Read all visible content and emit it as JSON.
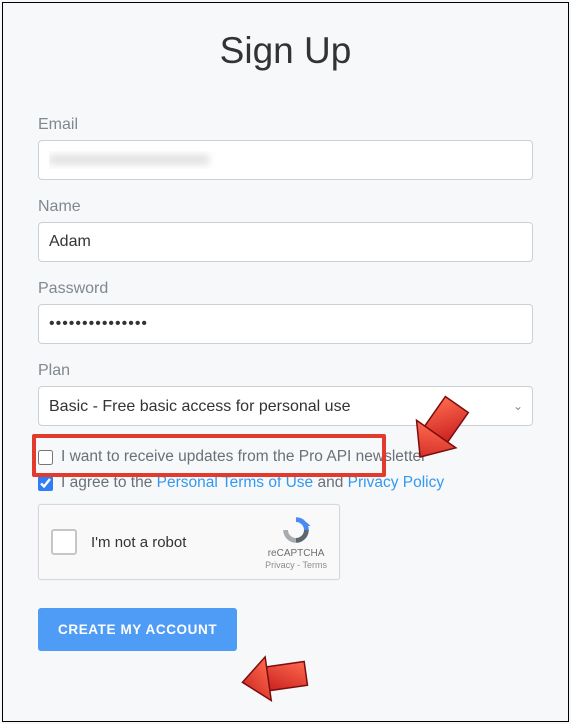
{
  "heading": "Sign Up",
  "fields": {
    "email": {
      "label": "Email",
      "value": "xxxxxxxxxxxxxxxxxxxx"
    },
    "name": {
      "label": "Name",
      "value": "Adam"
    },
    "password": {
      "label": "Password",
      "value": "•••••••••••••••"
    },
    "plan": {
      "label": "Plan",
      "selected": "Basic - Free basic access for personal use"
    }
  },
  "newsletter": {
    "checked": false,
    "label": "I want to receive updates from the Pro API newsletter"
  },
  "terms": {
    "checked": true,
    "prefix": "I agree to the ",
    "link1": "Personal Terms of Use",
    "mid": " and ",
    "link2": "Privacy Policy"
  },
  "recaptcha": {
    "label": "I'm not a robot",
    "brand": "reCAPTCHA",
    "privacy": "Privacy",
    "terms": "Terms",
    "sep": " - "
  },
  "submit_label": "CREATE MY ACCOUNT"
}
